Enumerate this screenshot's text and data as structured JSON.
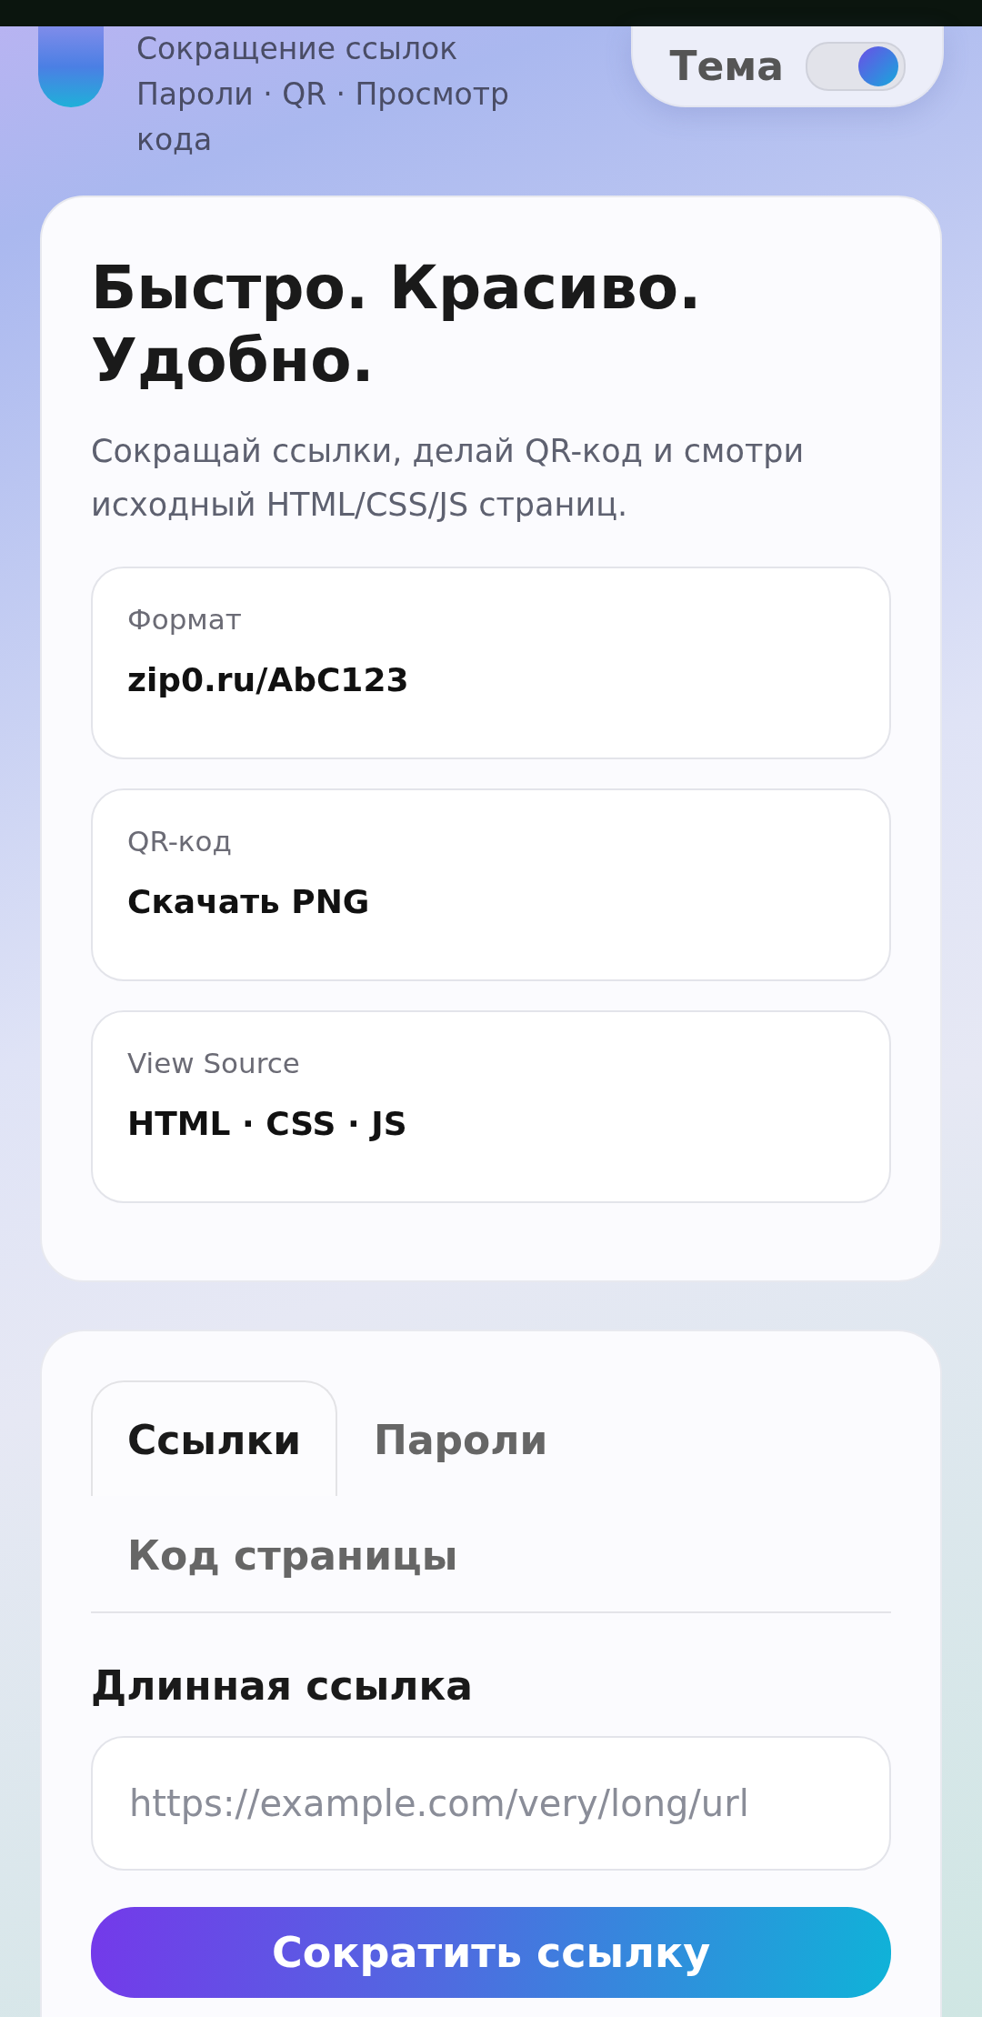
{
  "header": {
    "tagline": [
      "Сокращение ссылок",
      "Пароли · QR · Просмотр кода"
    ],
    "theme_toggle": {
      "label": "Тема",
      "on": true
    }
  },
  "hero": {
    "title": "Быстро. Красиво. Удобно.",
    "description": "Сокращай ссылки, делай QR-код и смотри исходный HTML/CSS/JS страниц.",
    "features": [
      {
        "label": "Формат",
        "value": "zip0.ru/AbC123"
      },
      {
        "label": "QR-код",
        "value": "Скачать PNG"
      },
      {
        "label": "View Source",
        "value": "HTML · CSS · JS"
      }
    ]
  },
  "tabs": [
    {
      "label": "Ссылки",
      "selected": true
    },
    {
      "label": "Пароли",
      "selected": false
    },
    {
      "label": "Код страницы",
      "selected": false
    }
  ],
  "form": {
    "label": "Длинная ссылка",
    "placeholder": "https://example.com/very/long/url",
    "submit": "Сократить ссылку"
  }
}
